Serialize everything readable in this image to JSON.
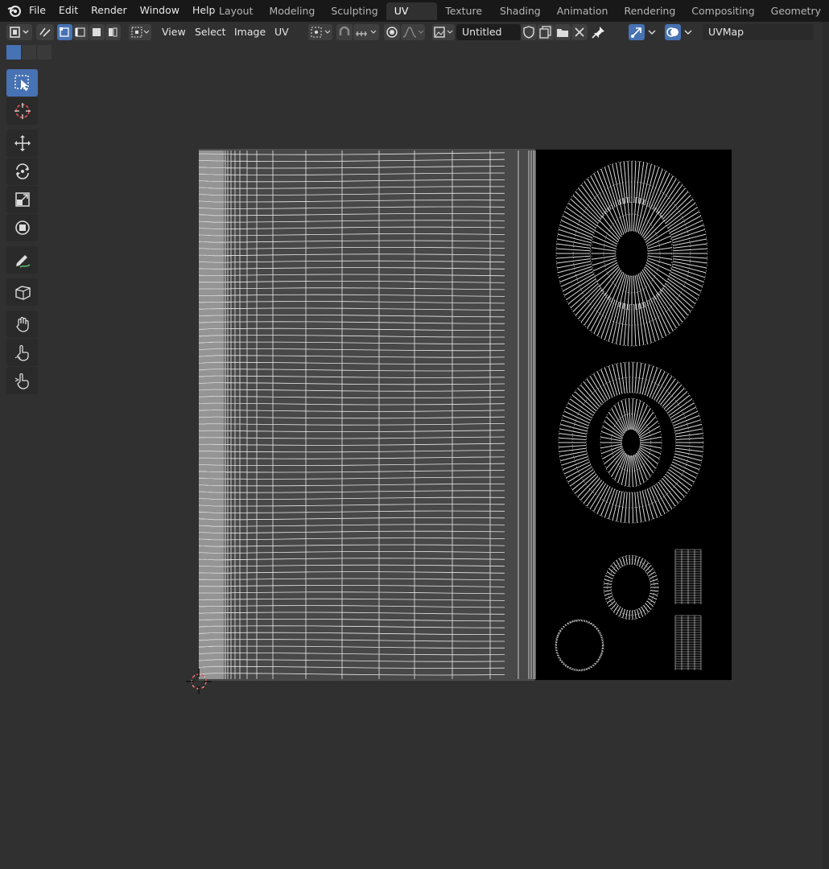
{
  "menu": {
    "file": "File",
    "edit": "Edit",
    "render": "Render",
    "window": "Window",
    "help": "Help"
  },
  "workspaces": [
    {
      "label": "Layout",
      "active": false
    },
    {
      "label": "Modeling",
      "active": false
    },
    {
      "label": "Sculpting",
      "active": false
    },
    {
      "label": "UV Editing",
      "active": true
    },
    {
      "label": "Texture Paint",
      "active": false
    },
    {
      "label": "Shading",
      "active": false
    },
    {
      "label": "Animation",
      "active": false
    },
    {
      "label": "Rendering",
      "active": false
    },
    {
      "label": "Compositing",
      "active": false
    },
    {
      "label": "Geometry Nodes",
      "active": false
    }
  ],
  "header": {
    "view": "View",
    "select": "Select",
    "image": "Image",
    "uv": "UV",
    "image_name": "Untitled",
    "uv_map": "UVMap"
  },
  "tools": [
    {
      "name": "select-box-tool",
      "icon": "select-box-icon",
      "active": true
    },
    {
      "name": "cursor-tool",
      "icon": "cursor-icon",
      "active": false
    },
    {
      "name": "move-tool",
      "icon": "move-icon",
      "active": false
    },
    {
      "name": "rotate-tool",
      "icon": "rotate-icon",
      "active": false
    },
    {
      "name": "scale-tool",
      "icon": "scale-icon",
      "active": false
    },
    {
      "name": "transform-tool",
      "icon": "transform-icon",
      "active": false
    },
    {
      "name": "annotate-tool",
      "icon": "annotate-icon",
      "active": false
    },
    {
      "name": "rip-region-tool",
      "icon": "rip-region-icon",
      "active": false
    },
    {
      "name": "grab-tool",
      "icon": "grab-icon",
      "active": false
    },
    {
      "name": "relax-tool",
      "icon": "relax-icon",
      "active": false
    },
    {
      "name": "pinch-tool",
      "icon": "pinch-icon",
      "active": false
    }
  ],
  "colors": {
    "accent": "#4772b3",
    "topbar": "#181818",
    "background": "#303030",
    "uv_bg": "#484848",
    "image_bg": "#000000",
    "wire": "#e0e0e0"
  }
}
